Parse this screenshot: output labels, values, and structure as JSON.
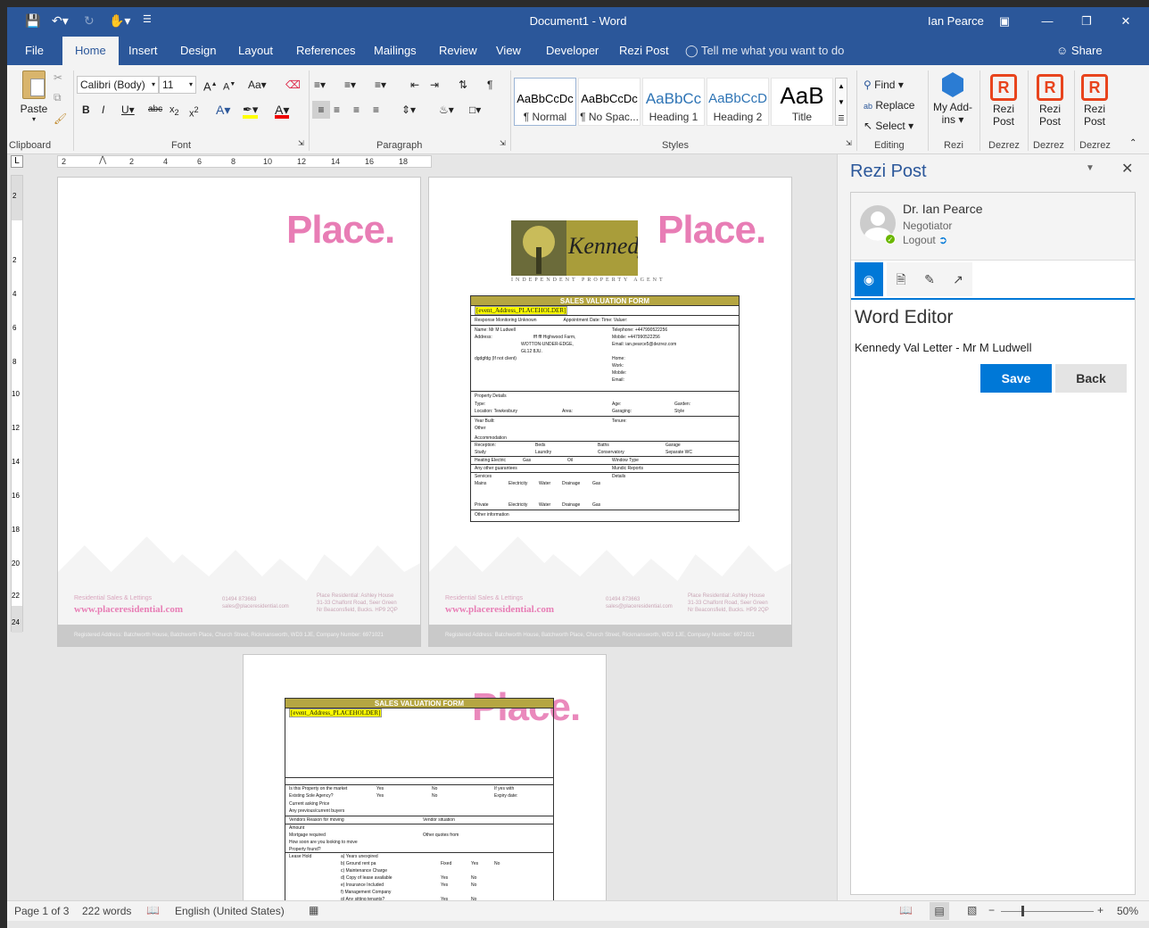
{
  "window": {
    "doc_title": "Document1  -  Word",
    "user": "Ian Pearce",
    "share": "Share",
    "tell_me": "Tell me what you want to do"
  },
  "tabs": [
    "File",
    "Home",
    "Insert",
    "Design",
    "Layout",
    "References",
    "Mailings",
    "Review",
    "View",
    "Developer",
    "Rezi Post"
  ],
  "ribbon": {
    "clipboard": {
      "paste": "Paste",
      "label": "Clipboard"
    },
    "font": {
      "name": "Calibri (Body)",
      "size": "11",
      "label": "Font"
    },
    "paragraph": {
      "label": "Paragraph"
    },
    "styles": {
      "label": "Styles",
      "items": [
        {
          "preview": "AaBbCcDc",
          "name": "¶ Normal"
        },
        {
          "preview": "AaBbCcDc",
          "name": "¶ No Spac..."
        },
        {
          "preview": "AaBbCc",
          "name": "Heading 1"
        },
        {
          "preview": "AaBbCcD",
          "name": "Heading 2"
        },
        {
          "preview": "AaB",
          "name": "Title"
        }
      ]
    },
    "editing": {
      "find": "Find",
      "replace": "Replace",
      "select": "Select",
      "label": "Editing"
    },
    "addins": {
      "label1": "My Add-",
      "label2": "ins",
      "group": "Rezi"
    },
    "rezi_buttons": [
      {
        "l1": "Rezi",
        "l2": "Post",
        "group": "Dezrez"
      },
      {
        "l1": "Rezi",
        "l2": "Post",
        "group": "Dezrez"
      },
      {
        "l1": "Rezi",
        "l2": "Post",
        "group": "Dezrez"
      }
    ]
  },
  "ruler": {
    "marks": [
      "2",
      "2",
      "4",
      "6",
      "8",
      "10",
      "12",
      "14",
      "16",
      "18"
    ]
  },
  "ruler_v": {
    "marks": [
      "2",
      "2",
      "4",
      "6",
      "8",
      "10",
      "12",
      "14",
      "16",
      "18",
      "20",
      "22",
      "24"
    ]
  },
  "pages": {
    "place_logo": "Place.",
    "footer_web": "www.placeresidential.com",
    "footer_left": "Residential Sales & Lettings",
    "footer_phone": "01494 873663",
    "footer_email": "sales@placeresidential.com",
    "footer_addr1": "Place Residential: Ashley House",
    "footer_addr2": "31-33 Chalfont Road, Seer Green",
    "footer_addr3": "Nr Beaconsfield, Bucks. HP9 2QP",
    "footer_band": "Registered Address: Batchworth House, Batchworth Place, Church Street, Rickmansworth, WD3 1JE, Company Number: 6971021",
    "kennedys": "Kennedys",
    "kennedys_sub": "INDEPENDENT PROPERTY AGENT",
    "form_title": "SALES VALUATION FORM",
    "placeholder": "[event_Address_PLACEHOLDER]",
    "form1": {
      "r1": "Response Monitoring Unknown",
      "r1b": "Appointment Date: Time: Valuer:",
      "name": "Name: Mr M Ludwell",
      "addr": "Address:",
      "addr1": "fff fff Highwood Farm,",
      "addr2": "WOTTON-UNDER-EDGE,",
      "addr3": "GL12 8JU.",
      "tel": "Telephone: +447990522256",
      "mob": "Mobile: +447990522256",
      "email": "Email: ian.pearce5@dezrez.com",
      "ifnot": "dgdgfdg (If not client)",
      "home": "Home:",
      "work": "Work:",
      "mobile": "Mobile:",
      "email2": "Email:",
      "pd": "Property Details",
      "type": "Type:",
      "age": "Age:",
      "garden": "Garden:",
      "loc": "Location: Tewkesbury",
      "area": "Area:",
      "garaging": "Garaging:",
      "style": "Style",
      "yb": "Year Built:",
      "tenure": "Tenure:",
      "other": "Other",
      "accom": "Accommodation",
      "reception": "Reception:",
      "beds": "Beds",
      "baths": "Baths",
      "garage": "Garage",
      "study": "Study",
      "laundry": "Laundry",
      "conservatory": "Conservatory",
      "sepwc": "Separate WC",
      "heating": "Heating Electric",
      "gas": "Gas",
      "oil": "Oil",
      "window": "Window Type",
      "guarantees": "Any other guarantees",
      "mundic": "Mundic Reports",
      "services": "Services",
      "details": "Details",
      "mains": "Mains",
      "private": "Private",
      "electricity": "Electricity",
      "water": "Water",
      "drainage": "Drainage",
      "gas2": "Gas",
      "otherinfo": "Other information"
    },
    "form2": {
      "q1": "Is this Property on the market",
      "q2": "Existing Sole Agency?",
      "yes": "Yes",
      "no": "No",
      "ifyes": "If yes with",
      "expiry": "Expiry date:",
      "price": "Current asking Price",
      "buyers": "Any previous/current buyers",
      "vendors": "Vendors Reason for moving",
      "situation": "Vendor situation",
      "amount": "Amount",
      "mortgage": "Mortgage required",
      "quotes": "Other quotes from",
      "howsoon": "How soon are you looking to move",
      "found": "Property found?",
      "lease": "Lease Hold",
      "la": "a)   Years unexpired",
      "lb": "b)   Ground rent pa",
      "lc": "c)   Maintenance Charge",
      "ld": "d)   Copy of lease available",
      "le": "e)   Insurance Included",
      "lf": "f)    Management Company",
      "lg": "g)   Any sitting tenants?",
      "fixed": "Fixed"
    }
  },
  "status": {
    "page": "Page 1 of 3",
    "words": "222 words",
    "lang": "English (United States)",
    "zoom": "50%",
    "zoom_level": 0.5
  },
  "taskpane": {
    "title": "Rezi Post",
    "user_name": "Dr. Ian Pearce",
    "role": "Negotiator",
    "logout": "Logout",
    "heading": "Word Editor",
    "doc_name": "Kennedy Val Letter - Mr M Ludwell",
    "save": "Save",
    "back": "Back"
  },
  "colors": {
    "word_blue": "#2b579a",
    "rezi_orange": "#e8441d",
    "place_pink": "#e87db5",
    "save_blue": "#0078d7",
    "form_header": "#b5a642"
  }
}
